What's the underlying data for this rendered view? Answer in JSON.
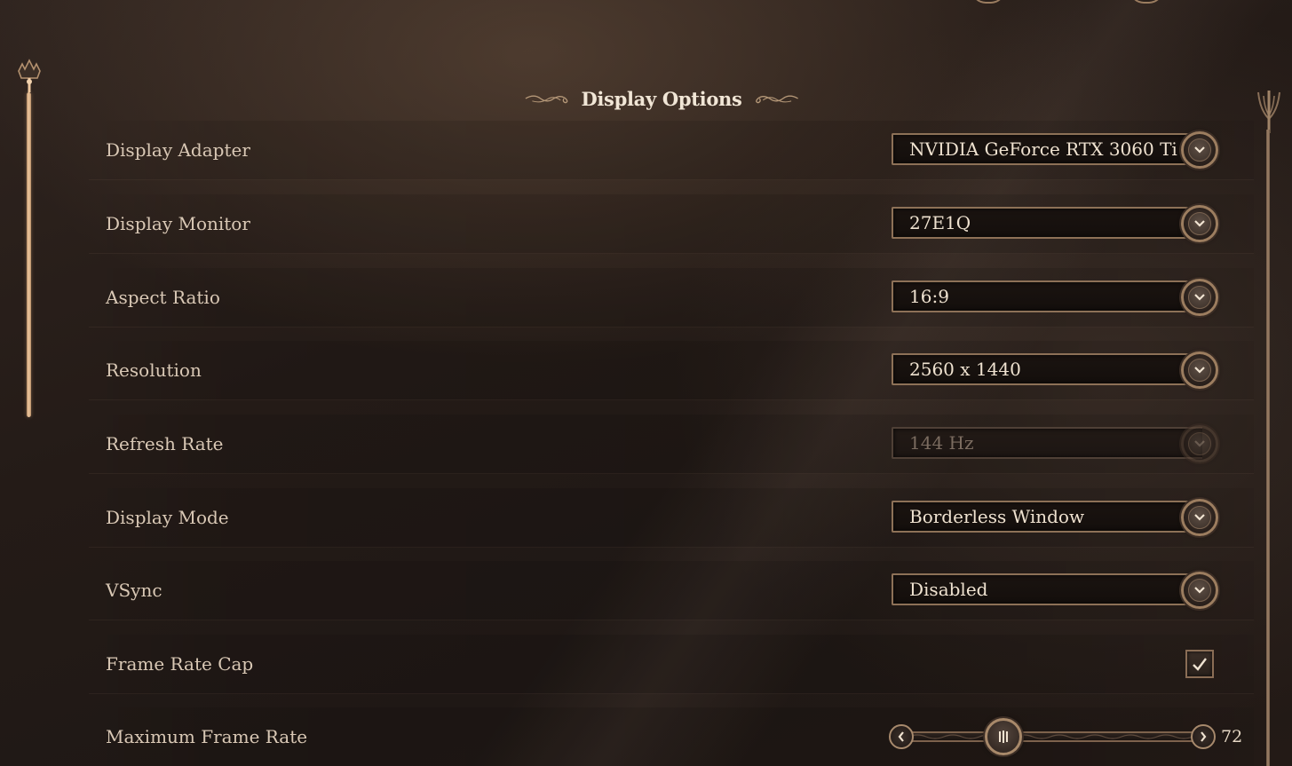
{
  "section": {
    "title": "Display Options"
  },
  "settings": {
    "display_adapter": {
      "label": "Display Adapter",
      "value": "NVIDIA GeForce RTX 3060 Ti"
    },
    "display_monitor": {
      "label": "Display Monitor",
      "value": "27E1Q"
    },
    "aspect_ratio": {
      "label": "Aspect Ratio",
      "value": "16:9"
    },
    "resolution": {
      "label": "Resolution",
      "value": "2560 x 1440"
    },
    "refresh_rate": {
      "label": "Refresh Rate",
      "value": "144 Hz",
      "enabled": false
    },
    "display_mode": {
      "label": "Display Mode",
      "value": "Borderless Window"
    },
    "vsync": {
      "label": "VSync",
      "value": "Disabled"
    },
    "frame_rate_cap": {
      "label": "Frame Rate Cap",
      "checked": true
    },
    "maximum_frame_rate": {
      "label": "Maximum Frame Rate",
      "value": "72",
      "slider_fraction": 0.34
    }
  },
  "colors": {
    "accent_gold": "#9c7d5f",
    "text_primary": "#d9c8b5",
    "text_value": "#efe2d0",
    "text_disabled": "#7b6c60",
    "background": "#241b17",
    "scrollbar_highlight": "#f0c9a0"
  },
  "icons": {
    "dropdown": "chevron-down-icon",
    "checkbox": "checkmark-icon",
    "slider_left": "chevron-left-icon",
    "slider_right": "chevron-right-icon",
    "slider_thumb": "grip-icon"
  }
}
